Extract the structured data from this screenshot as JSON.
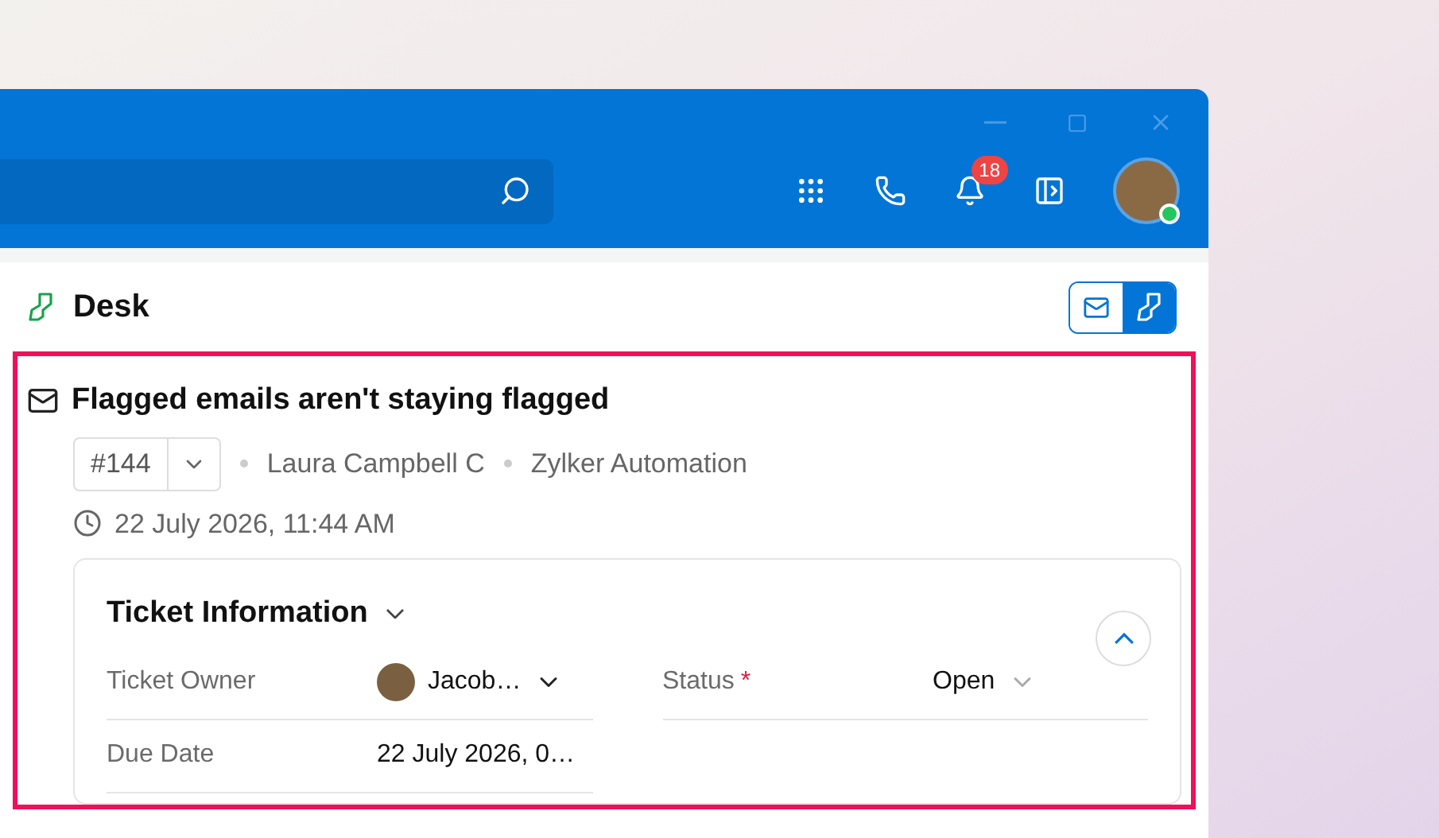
{
  "header": {
    "notification_badge": "18",
    "user_online": true
  },
  "app": {
    "title": "Desk",
    "views": [
      {
        "kind": "mail",
        "selected": false
      },
      {
        "kind": "desk",
        "selected": true
      }
    ]
  },
  "ticket": {
    "title": "Flagged emails aren't staying flagged",
    "number": "#144",
    "contact": "Laura Campbell C",
    "account": "Zylker Automation",
    "created": "22 July 2026, 11:44 AM",
    "section": {
      "title": "Ticket Information",
      "expanded": true,
      "fields": [
        {
          "label": "Ticket Owner",
          "value": "Jacob…",
          "kind": "owner"
        },
        {
          "label": "Status",
          "required_mark": "*",
          "value": "Open",
          "kind": "select"
        },
        {
          "label": "Due Date",
          "value": "22 July 2026, 0…",
          "kind": "text"
        }
      ]
    }
  }
}
